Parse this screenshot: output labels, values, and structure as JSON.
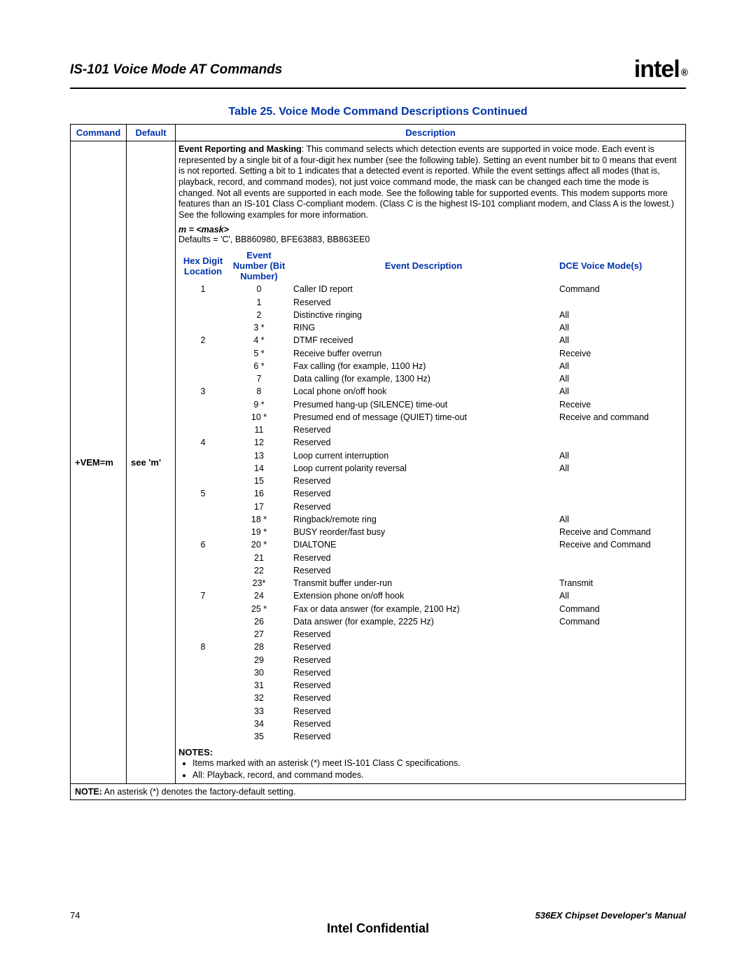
{
  "header": {
    "title": "IS-101 Voice Mode AT Commands",
    "logo_text": "intel",
    "logo_reg": "®"
  },
  "caption": "Table 25.  Voice Mode Command Descriptions Continued",
  "outer_headers": {
    "command": "Command",
    "default": "Default",
    "description": "Description"
  },
  "row": {
    "command": "+VEM=m",
    "default": "see 'm'",
    "description_bold": "Event Reporting and Masking",
    "description_rest": ": This command selects which detection events are supported in voice mode. Each event is represented by a single bit of a four-digit hex number (see the following table). Setting an event number bit to 0 means that event is not reported. Setting a bit to 1 indicates that a detected event is reported. While the event settings affect all modes (that is, playback, record, and command modes), not just voice command mode, the mask can be changed each time the mode is changed. Not all events are supported in each mode. See the following table for supported events. This modem supports more features than an IS-101 Class C-compliant modem. (Class C is the highest IS-101 compliant modem, and Class A is the lowest.) See the following examples for more information.",
    "mask_label": "m = <mask>",
    "defaults_line": "Defaults = 'C', BB860980, BFE63883, BB863EE0",
    "inner_headers": {
      "hex": "Hex Digit Location",
      "event_num": "Event Number (Bit Number)",
      "event_desc": "Event Description",
      "dce": "DCE Voice Mode(s)"
    },
    "events": [
      {
        "hex": "1",
        "num": "0",
        "desc": "Caller ID report",
        "mode": "Command"
      },
      {
        "hex": "",
        "num": "1",
        "desc": "Reserved",
        "mode": ""
      },
      {
        "hex": "",
        "num": "2",
        "desc": "Distinctive ringing",
        "mode": "All"
      },
      {
        "hex": "",
        "num": "3 *",
        "desc": "RING",
        "mode": "All"
      },
      {
        "hex": "2",
        "num": "4 *",
        "desc": "DTMF received",
        "mode": "All"
      },
      {
        "hex": "",
        "num": "5 *",
        "desc": "Receive buffer overrun",
        "mode": "Receive"
      },
      {
        "hex": "",
        "num": "6 *",
        "desc": "Fax calling (for example, 1100 Hz)",
        "mode": "All"
      },
      {
        "hex": "",
        "num": "7",
        "desc": "Data calling (for example, 1300 Hz)",
        "mode": "All"
      },
      {
        "hex": "3",
        "num": "8",
        "desc": "Local phone on/off hook",
        "mode": "All"
      },
      {
        "hex": "",
        "num": "9 *",
        "desc": "Presumed hang-up (SILENCE) time-out",
        "mode": "Receive"
      },
      {
        "hex": "",
        "num": "10 *",
        "desc": "Presumed end of message (QUIET) time-out",
        "mode": "Receive and command"
      },
      {
        "hex": "",
        "num": "11",
        "desc": "Reserved",
        "mode": ""
      },
      {
        "hex": "4",
        "num": "12",
        "desc": "Reserved",
        "mode": ""
      },
      {
        "hex": "",
        "num": "13",
        "desc": "Loop current interruption",
        "mode": "All"
      },
      {
        "hex": "",
        "num": "14",
        "desc": "Loop current polarity reversal",
        "mode": "All"
      },
      {
        "hex": "",
        "num": "15",
        "desc": "Reserved",
        "mode": ""
      },
      {
        "hex": "5",
        "num": "16",
        "desc": "Reserved",
        "mode": ""
      },
      {
        "hex": "",
        "num": "17",
        "desc": "Reserved",
        "mode": ""
      },
      {
        "hex": "",
        "num": "18 *",
        "desc": "Ringback/remote ring",
        "mode": "All"
      },
      {
        "hex": "",
        "num": "19 *",
        "desc": "BUSY reorder/fast busy",
        "mode": "Receive and Command"
      },
      {
        "hex": "6",
        "num": "20 *",
        "desc": "DIALTONE",
        "mode": "Receive and Command"
      },
      {
        "hex": "",
        "num": "21",
        "desc": "Reserved",
        "mode": ""
      },
      {
        "hex": "",
        "num": "22",
        "desc": "Reserved",
        "mode": ""
      },
      {
        "hex": "",
        "num": "23*",
        "desc": "Transmit buffer under-run",
        "mode": "Transmit"
      },
      {
        "hex": "7",
        "num": "24",
        "desc": "Extension phone on/off hook",
        "mode": "All"
      },
      {
        "hex": "",
        "num": "25 *",
        "desc": "Fax or data answer (for example, 2100 Hz)",
        "mode": "Command"
      },
      {
        "hex": "",
        "num": "26",
        "desc": "Data answer (for example, 2225 Hz)",
        "mode": "Command"
      },
      {
        "hex": "",
        "num": "27",
        "desc": "Reserved",
        "mode": ""
      },
      {
        "hex": "8",
        "num": "28",
        "desc": "Reserved",
        "mode": ""
      },
      {
        "hex": "",
        "num": "29",
        "desc": "Reserved",
        "mode": ""
      },
      {
        "hex": "",
        "num": "30",
        "desc": "Reserved",
        "mode": ""
      },
      {
        "hex": "",
        "num": "31",
        "desc": "Reserved",
        "mode": ""
      },
      {
        "hex": "",
        "num": "32",
        "desc": "Reserved",
        "mode": ""
      },
      {
        "hex": "",
        "num": "33",
        "desc": "Reserved",
        "mode": ""
      },
      {
        "hex": "",
        "num": "34",
        "desc": "Reserved",
        "mode": ""
      },
      {
        "hex": "",
        "num": "35",
        "desc": "Reserved",
        "mode": ""
      }
    ],
    "notes_heading": "NOTES:",
    "notes": [
      "Items marked with an asterisk (*) meet IS-101 Class C specifications.",
      "All: Playback, record, and command modes."
    ]
  },
  "table_note_label": "NOTE:",
  "table_note_text": " An asterisk (*) denotes the factory-default setting.",
  "footer": {
    "page_number": "74",
    "manual": "536EX Chipset Developer's Manual",
    "confidential": "Intel Confidential"
  }
}
